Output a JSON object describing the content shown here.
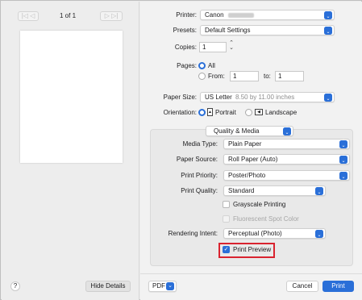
{
  "preview": {
    "page_indicator": "1 of 1",
    "hide_details": "Hide Details",
    "help": "?"
  },
  "printer": {
    "label": "Printer:",
    "value": "Canon"
  },
  "presets": {
    "label": "Presets:",
    "value": "Default Settings"
  },
  "copies": {
    "label": "Copies:",
    "value": "1"
  },
  "pages": {
    "label": "Pages:",
    "all": "All",
    "from": "From:",
    "from_value": "1",
    "to": "to:",
    "to_value": "1"
  },
  "paper_size": {
    "label": "Paper Size:",
    "value": "US Letter",
    "dims": "8.50 by 11.00 inches"
  },
  "orientation": {
    "label": "Orientation:",
    "portrait": "Portrait",
    "landscape": "Landscape"
  },
  "section": {
    "value": "Quality & Media"
  },
  "media_type": {
    "label": "Media Type:",
    "value": "Plain Paper"
  },
  "paper_source": {
    "label": "Paper Source:",
    "value": "Roll Paper (Auto)"
  },
  "print_priority": {
    "label": "Print Priority:",
    "value": "Poster/Photo"
  },
  "print_quality": {
    "label": "Print Quality:",
    "value": "Standard"
  },
  "grayscale": {
    "label": "Grayscale Printing"
  },
  "fluorescent": {
    "label": "Fluorescent Spot Color"
  },
  "rendering_intent": {
    "label": "Rendering Intent:",
    "value": "Perceptual (Photo)"
  },
  "print_preview": {
    "label": "Print Preview"
  },
  "footer": {
    "pdf": "PDF",
    "cancel": "Cancel",
    "print": "Print"
  },
  "colors": {
    "accent": "#2a6fd8",
    "highlight": "#d9232f"
  }
}
